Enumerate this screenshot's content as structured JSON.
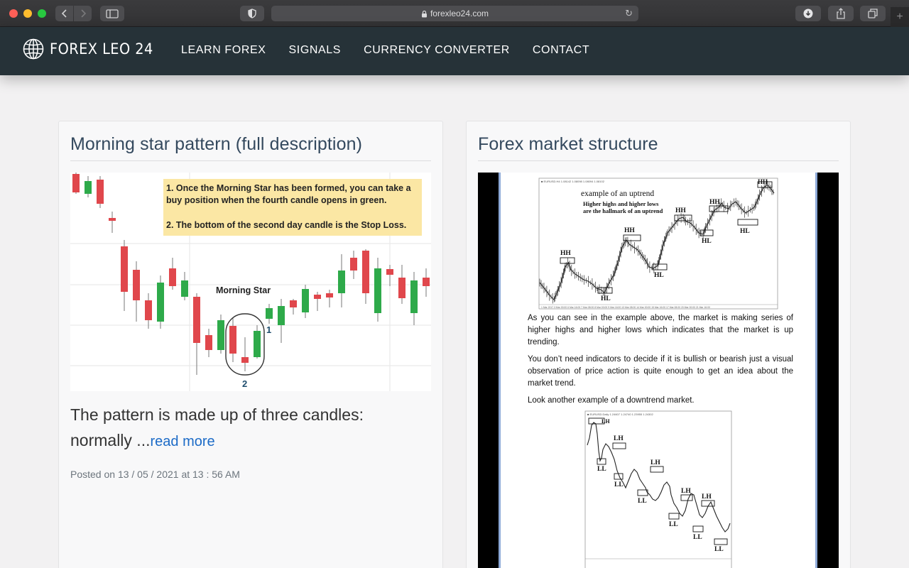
{
  "browser": {
    "url": "forexleo24.com"
  },
  "site": {
    "logo_text": "FOREX LEO 24",
    "nav": [
      {
        "label": "LEARN FOREX"
      },
      {
        "label": "SIGNALS"
      },
      {
        "label": "CURRENCY CONVERTER"
      },
      {
        "label": "CONTACT"
      }
    ]
  },
  "posts": [
    {
      "title": "Morning star pattern (full description)",
      "image_text": {
        "note_1": "1. Once the Morning Star has been formed, you can take a buy position when the fourth candle opens in green.",
        "note_2": "2. The bottom of the second day candle is the Stop Loss.",
        "pattern_label": "Morning Star",
        "marker_1": "1",
        "marker_2": "2"
      },
      "excerpt": "The pattern is made up of three candles: normally ...",
      "read_more": "read more",
      "posted": "Posted on 13 / 05 / 2021 at 13 : 56 AM"
    },
    {
      "title": "Forex market structure",
      "image_text": {
        "chart1_title": "example of an uptrend",
        "chart1_subtitle_1": "Higher highs and higher lows",
        "chart1_subtitle_2": "are the hallmark of an uptrend",
        "hh": "HH",
        "hl": "HL",
        "lh": "LH",
        "ll": "LL",
        "para_1": "As you can see in the example above, the market is making series of higher highs and higher lows which indicates that the market is up trending.",
        "para_2": "You don’t need indicators to decide if it is bullish or bearish just a visual observation of price action is quite enough to get an idea about the market trend.",
        "para_3": "Look another example of a downtrend market."
      }
    }
  ],
  "colors": {
    "nav_bg": "#263238",
    "title": "#34495e",
    "link": "#1c6bc7",
    "bull": "#2eaa4a",
    "bear": "#e0474c"
  }
}
